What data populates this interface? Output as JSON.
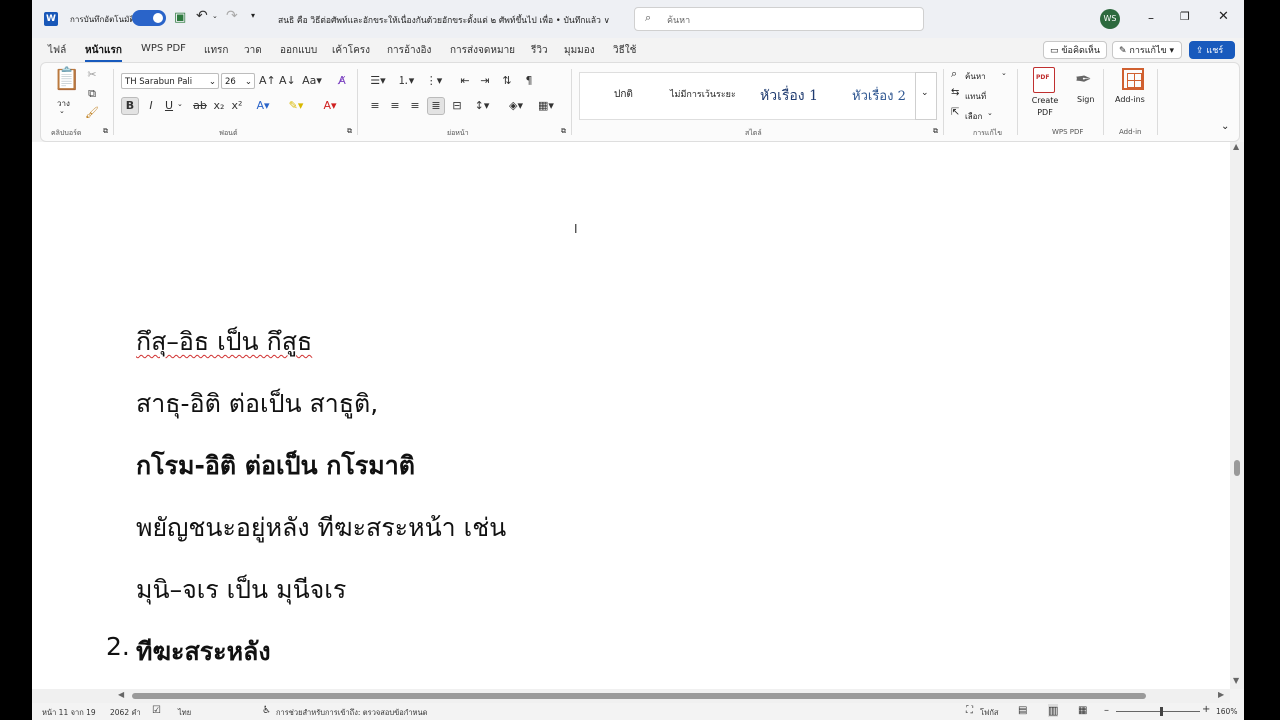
{
  "titlebar": {
    "app_icon": "W",
    "autosave_label": "การบันทึกอัตโนมัติ",
    "title": "สนธิ คือ วิธีต่อศัพท์และอักขระให้เนื่องกันด้วยอักขระตั้งแต่ ๒ ศัพท์ขึ้นไป เพื่อ • บันทึกแล้ว ∨",
    "search_placeholder": "ค้นหา",
    "avatar_initials": "WS",
    "save_icon": "floppy-icon",
    "undo_icon": "undo-icon",
    "redo_icon": "redo-icon"
  },
  "menu": {
    "tabs": [
      "ไฟล์",
      "หน้าแรก",
      "WPS PDF",
      "แทรก",
      "วาด",
      "ออกแบบ",
      "เค้าโครง",
      "การอ้างอิง",
      "การส่งจดหมาย",
      "รีวิว",
      "มุมมอง",
      "วิธีใช้"
    ],
    "comments_label": "ข้อคิดเห็น",
    "editing_label": "การแก้ไข",
    "share_label": "แชร์"
  },
  "ribbon": {
    "clipboard": {
      "paste_label": "วาง",
      "group_label": "คลิปบอร์ด"
    },
    "font": {
      "font_name": "TH Sarabun Pali",
      "font_size": "26",
      "group_label": "ฟอนต์"
    },
    "paragraph": {
      "group_label": "ย่อหน้า"
    },
    "styles": {
      "items": [
        "ปกติ",
        "ไม่มีการเว้นระยะ",
        "หัวเรื่อง 1",
        "หัวเรื่อง 2"
      ],
      "group_label": "สไตล์"
    },
    "editing": {
      "find_label": "ค้นหา",
      "replace_label": "แทนที่",
      "select_label": "เลือก",
      "group_label": "การแก้ไข"
    },
    "wps": {
      "create_pdf_label": "Create PDF",
      "sign_label": "Sign",
      "group_label": "WPS PDF"
    },
    "addins": {
      "label": "Add-ins",
      "group_label": "Add-in"
    }
  },
  "document": {
    "lines": [
      "กึสุ–อิธ เป็น กึสูธ",
      "สาธุ-อิติ ต่อเป็น สาธูติ,",
      "กโรม-อิติ ต่อเป็น กโรมาติ",
      "พยัญชนะอยู่หลัง ทีฆะสระหน้า  เช่น",
      "มุนิ–จเร เป็น มุนีจเร"
    ],
    "numbered_item_number": "2.",
    "numbered_item_text": "ทีฆะสระหลัง"
  },
  "statusbar": {
    "page": "หน้า 11 จาก 19",
    "words": "2062 คำ",
    "language": "ไทย",
    "accessibility": "การช่วยสำหรับการเข้าถึง: ตรวจสอบข้อกำหนด",
    "focus": "โฟกัส",
    "zoom": "160%"
  }
}
